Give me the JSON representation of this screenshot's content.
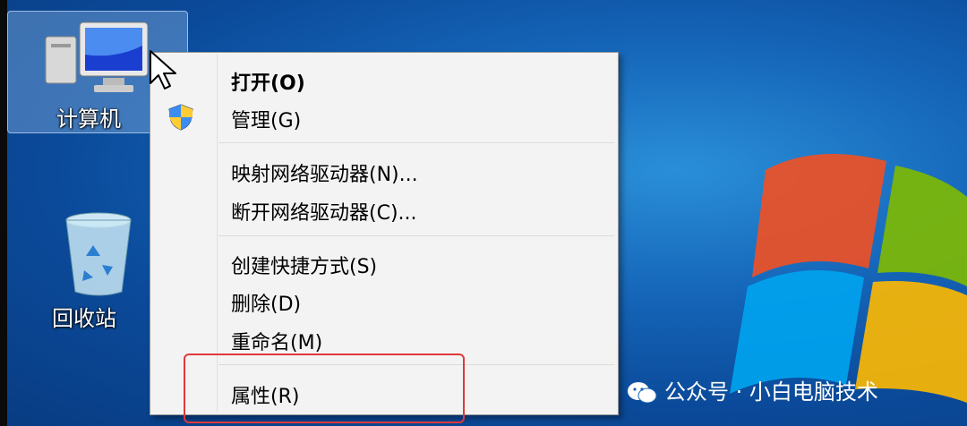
{
  "desktop": {
    "icons": [
      {
        "label": "计算机"
      },
      {
        "label": "回收站"
      }
    ]
  },
  "context_menu": {
    "items": [
      {
        "label": "打开(O)",
        "bold": true
      },
      {
        "label": "管理(G)"
      },
      {
        "label": "映射网络驱动器(N)..."
      },
      {
        "label": "断开网络驱动器(C)..."
      },
      {
        "label": "创建快捷方式(S)"
      },
      {
        "label": "删除(D)"
      },
      {
        "label": "重命名(M)"
      },
      {
        "label": "属性(R)"
      }
    ]
  },
  "watermark": {
    "text": "公众号 · 小白电脑技术"
  },
  "colors": {
    "highlight": "#e0383a",
    "desktop_bg": "#1565b8"
  }
}
